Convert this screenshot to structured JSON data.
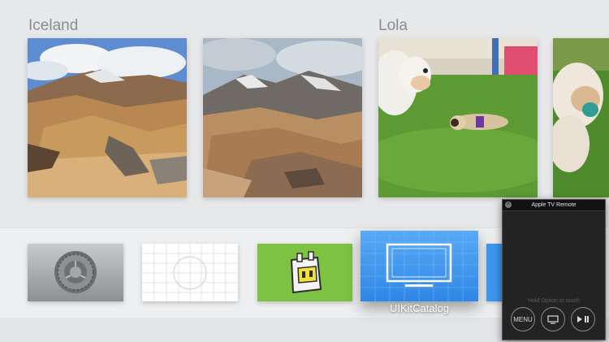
{
  "sections": [
    {
      "title": "Iceland"
    },
    {
      "title": "Lola"
    }
  ],
  "photos": [
    {
      "name": "iceland-photo-1",
      "icon": "landscape"
    },
    {
      "name": "iceland-photo-2",
      "icon": "landscape"
    },
    {
      "name": "lola-photo-1",
      "icon": "dogs"
    },
    {
      "name": "lola-photo-2",
      "icon": "dog"
    }
  ],
  "apps": {
    "focused_label": "UIKitCatalog",
    "items": [
      {
        "icon": "settings-gear-icon"
      },
      {
        "icon": "calibration-grid-icon"
      },
      {
        "icon": "robot-app-icon"
      },
      {
        "icon": "monitor-icon",
        "focused": true
      },
      {
        "icon": "partial-app-icon"
      }
    ]
  },
  "remote": {
    "title": "Apple TV Remote",
    "hint": "Hold Option to touch",
    "menu_label": "MENU",
    "buttons": [
      "menu",
      "tv-icon",
      "play-pause-icon"
    ]
  },
  "colors": {
    "background": "#e7e8ea",
    "focused_app": "#3f9af0",
    "green_app": "#7dc242",
    "remote_bg": "#232323"
  }
}
